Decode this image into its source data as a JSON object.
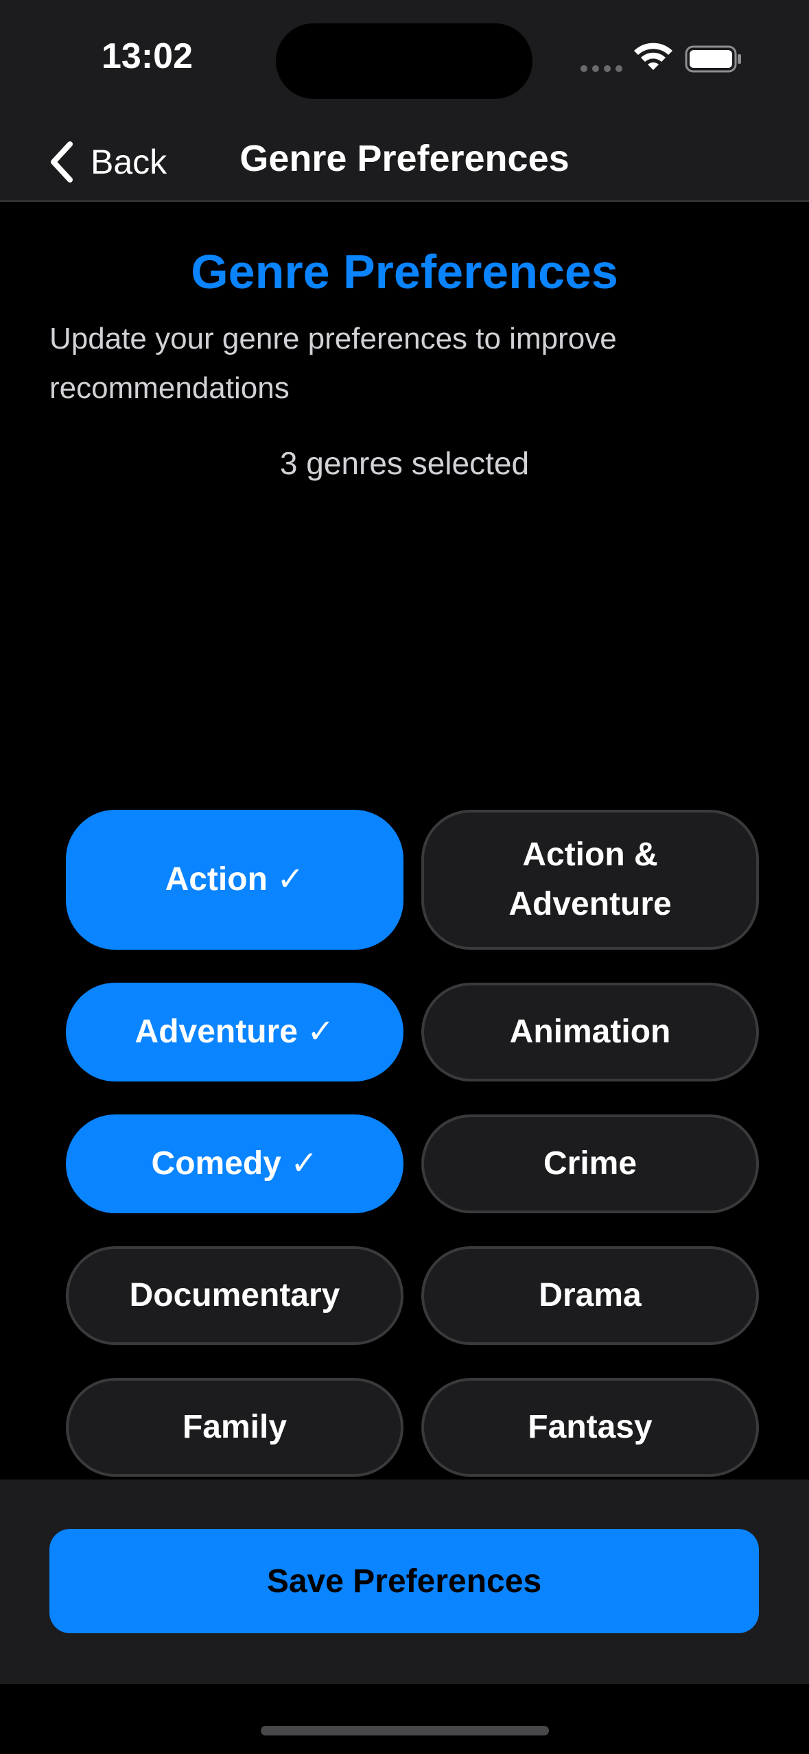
{
  "status_bar": {
    "time": "13:02",
    "icons": [
      "signal-dots-icon",
      "wifi-icon",
      "battery-icon"
    ]
  },
  "nav": {
    "back_label": "Back",
    "title": "Genre Preferences"
  },
  "content": {
    "heading": "Genre Preferences",
    "subtitle": "Update your genre preferences to improve recommendations",
    "selected_count": "3 genres selected"
  },
  "genres": [
    {
      "label": "Action",
      "selected": true
    },
    {
      "label": "Action & Adventure",
      "selected": false
    },
    {
      "label": "Adventure",
      "selected": true
    },
    {
      "label": "Animation",
      "selected": false
    },
    {
      "label": "Comedy",
      "selected": true
    },
    {
      "label": "Crime",
      "selected": false
    },
    {
      "label": "Documentary",
      "selected": false
    },
    {
      "label": "Drama",
      "selected": false
    },
    {
      "label": "Family",
      "selected": false
    },
    {
      "label": "Fantasy",
      "selected": false
    }
  ],
  "check_mark": "✓",
  "footer": {
    "save_label": "Save Preferences"
  },
  "colors": {
    "accent": "#0a84ff",
    "background": "#000000",
    "surface": "#1c1c1e",
    "border": "#3a3a3c"
  }
}
